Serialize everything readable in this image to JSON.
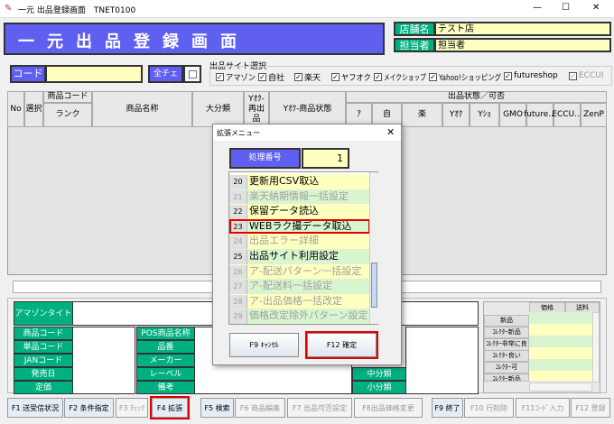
{
  "window": {
    "title": "一元 出品登録画面　TNET0100",
    "minimize": "—",
    "maximize": "☐",
    "close": "✕"
  },
  "header": {
    "title": "一元出品登録画面",
    "store_label": "店舗名称",
    "store_value": "テスト店",
    "staff_label": "担当者",
    "staff_value": "担当者"
  },
  "code": {
    "label": "コード",
    "value": "",
    "all_check": "全チェック"
  },
  "sites": {
    "label": "出品サイト選択",
    "items": [
      "アマゾン",
      "自社",
      "楽天",
      "ヤフオク",
      "メイクショップ",
      "Yahoo!ショッピング",
      "futureshop",
      "ECCUI"
    ]
  },
  "table": {
    "headers": {
      "no": "No",
      "select": "選択",
      "code": "商品コード",
      "rank": "ランク",
      "name": "商品名称",
      "category": "大分類",
      "relist": "Yｵｸ-再出品",
      "condition": "Yｵｸ-商品状態",
      "status_group": "出品状態／可否"
    },
    "status_cols": [
      "ｱ",
      "自",
      "楽",
      "Yｵｸ",
      "Yｼｮ",
      "GMO",
      "future...",
      "ECCU...",
      "ZenP"
    ]
  },
  "detail": {
    "amazon_title": "アマゾンタイトル",
    "product_code": "商品コード",
    "item_code": "単品コード",
    "jan": "JANコード",
    "release": "発売日",
    "price": "定価",
    "pos_name": "POS商品名称",
    "part_no": "品番",
    "maker": "メーカー",
    "label": "レーベル",
    "note": "備考",
    "mid_cat": "中分類",
    "small_cat": "小分類"
  },
  "conditions": {
    "headers": [
      "価格",
      "送料"
    ],
    "rows": [
      "新品",
      "ｺﾚｸﾀｰ新品",
      "ｺﾚｸﾀｰ非常に良い",
      "ｺﾚｸﾀｰ良い",
      "ｺﾚｸﾀｰ可",
      "ｺﾚｸﾀｰ新品"
    ]
  },
  "dialog": {
    "title": "拡張メニュー",
    "close": "✕",
    "proc_label": "処理番号",
    "proc_value": "1",
    "items": [
      {
        "n": "20",
        "t": "更新用CSV取込",
        "on": true
      },
      {
        "n": "21",
        "t": "楽天納期情報一括設定",
        "on": false
      },
      {
        "n": "22",
        "t": "保留データ読込",
        "on": true
      },
      {
        "n": "23",
        "t": "WEBラク撮データ取込",
        "on": true
      },
      {
        "n": "24",
        "t": "出品エラー詳細",
        "on": false
      },
      {
        "n": "25",
        "t": "出品サイト利用設定",
        "on": true
      },
      {
        "n": "26",
        "t": "ア-配送パターン一括設定",
        "on": false
      },
      {
        "n": "27",
        "t": "ア-配送料一括設定",
        "on": false
      },
      {
        "n": "28",
        "t": "ア-出品価格一括改定",
        "on": false
      },
      {
        "n": "29",
        "t": "価格改定除外パターン設定",
        "on": false
      }
    ],
    "cancel": "F9 ｷｬﾝｾﾙ",
    "ok": "F12 確定"
  },
  "fkeys": [
    {
      "t": "F1 送受信状況",
      "en": true
    },
    {
      "t": "F2 条件指定",
      "en": true
    },
    {
      "t": "F3 ﾁｪｯｸ",
      "en": false
    },
    {
      "t": "F4 拡張",
      "en": true
    },
    {
      "t": "F5 検索",
      "en": true
    },
    {
      "t": "F6 商品編集",
      "en": false
    },
    {
      "t": "F7 出品可否設定",
      "en": false
    },
    {
      "t": "F8出品価格変更",
      "en": false
    },
    {
      "t": "F9 終了",
      "en": true
    },
    {
      "t": "F10 行削除",
      "en": false
    },
    {
      "t": "F11ｺｰﾄﾞ入力",
      "en": false
    },
    {
      "t": "F12 登録",
      "en": false
    }
  ]
}
